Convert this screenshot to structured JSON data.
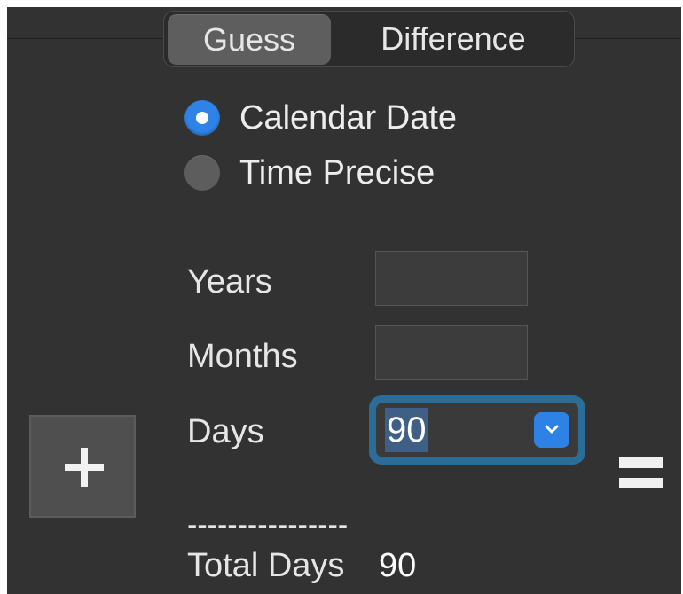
{
  "tabs": {
    "guess": "Guess",
    "difference": "Difference",
    "selected": "Guess"
  },
  "mode": {
    "calendar_date": "Calendar Date",
    "time_precise": "Time Precise",
    "selected": "Calendar Date"
  },
  "fields": {
    "years_label": "Years",
    "years_value": "",
    "months_label": "Months",
    "months_value": "",
    "days_label": "Days",
    "days_value": "90"
  },
  "operator": "+",
  "equals": "=",
  "divider": "----------------",
  "result": {
    "label": "Total Days",
    "value": "90"
  },
  "colors": {
    "panel_bg": "#323232",
    "accent": "#2f83e6",
    "focus_ring": "#2b6c98"
  }
}
